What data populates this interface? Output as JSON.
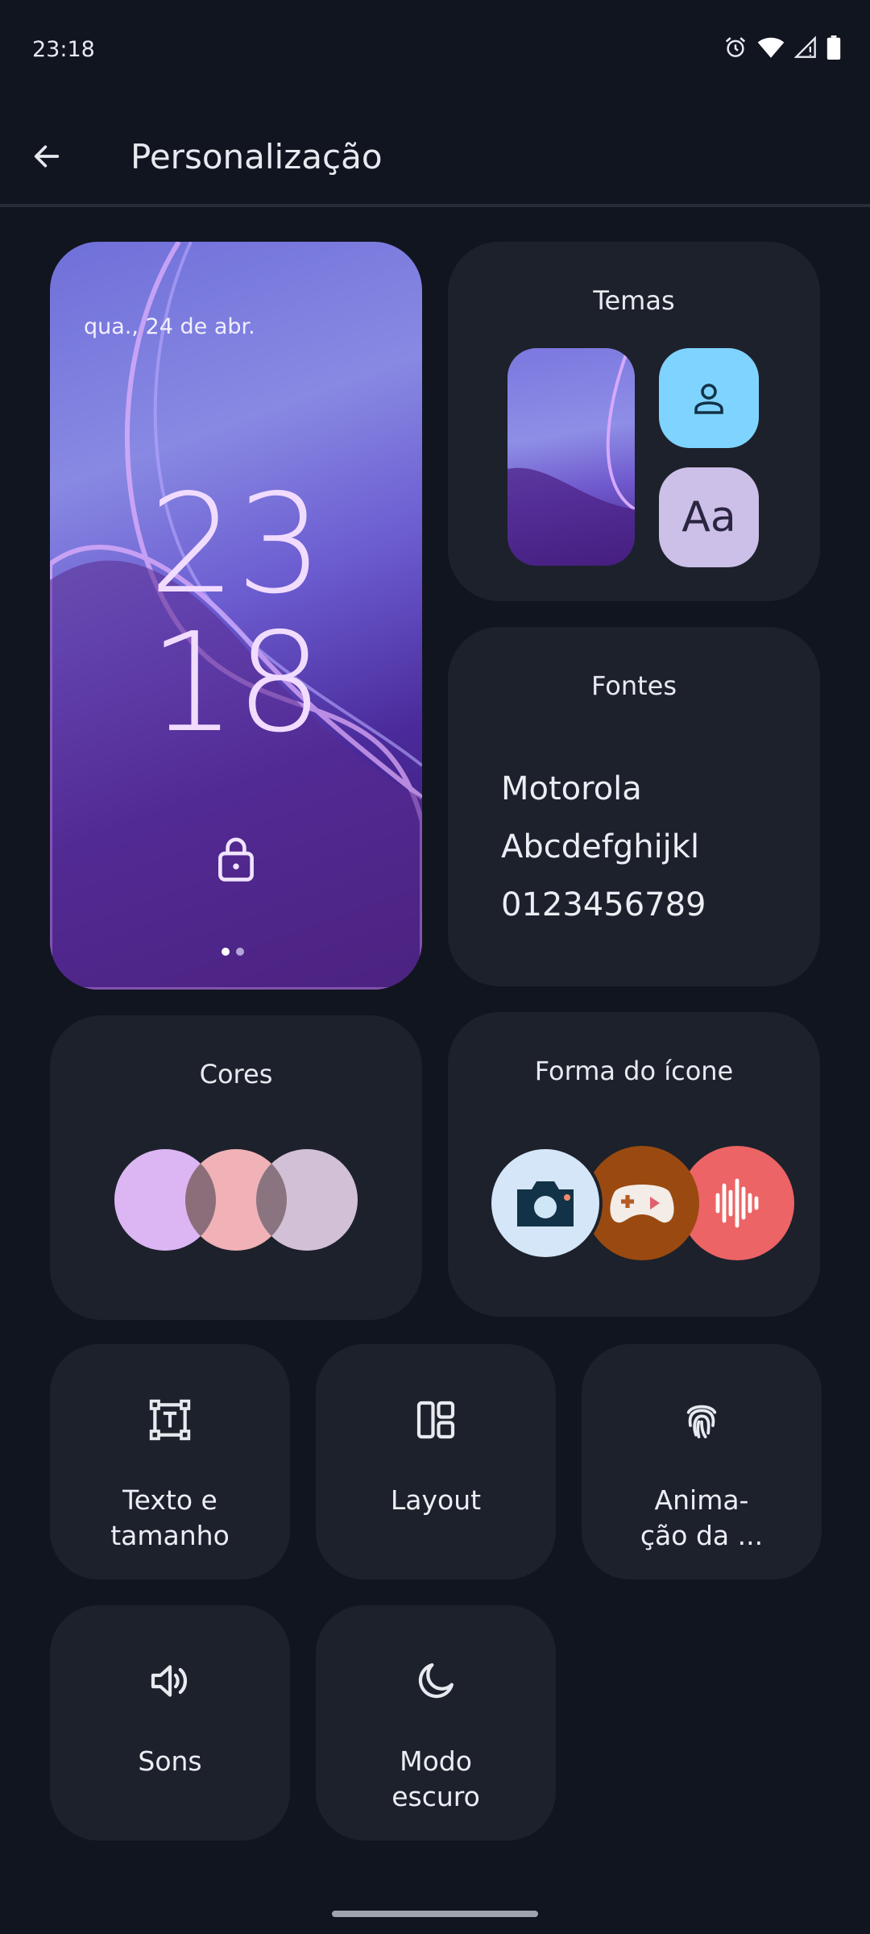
{
  "status": {
    "time": "23:18",
    "icons": [
      "alarm-icon",
      "wifi-icon",
      "signal-icon",
      "battery-icon"
    ]
  },
  "header": {
    "back_icon": "arrow-left-icon",
    "title": "Personalização"
  },
  "lockscreen_preview": {
    "date": "qua., 24 de abr.",
    "clock_hours": "23",
    "clock_minutes": "18",
    "lock_icon": "lock-icon",
    "page_indicator": {
      "pages": 2,
      "current": 1
    }
  },
  "themes_card": {
    "title": "Temas",
    "person_icon": "person-icon",
    "font_sample": "Aa"
  },
  "fonts_card": {
    "title": "Fontes",
    "lines": [
      "Motorola",
      "Abcdefghijkl",
      "0123456789"
    ]
  },
  "colors_card": {
    "title": "Cores",
    "swatches": [
      "#dcb5f3",
      "#f0b2b6",
      "#d2c0d6"
    ]
  },
  "icon_shape_card": {
    "title": "Forma do ícone",
    "icons": [
      "camera-icon",
      "game-icon",
      "audio-icon"
    ]
  },
  "tiles": [
    {
      "label_1": "Texto e",
      "label_2": "tamanho",
      "icon": "text-size-icon"
    },
    {
      "label_1": "Layout",
      "label_2": "",
      "icon": "layout-icon"
    },
    {
      "label_1": "Anima-",
      "label_2": "ção da ...",
      "icon": "fingerprint-icon"
    },
    {
      "label_1": "Sons",
      "label_2": "",
      "icon": "speaker-icon"
    },
    {
      "label_1": "Modo",
      "label_2": "escuro",
      "icon": "moon-icon"
    }
  ],
  "colors": {
    "background": "#111520",
    "card": "#1d212b",
    "accent_blue": "#7fd3ff",
    "accent_lilac": "#ccbfe8"
  }
}
